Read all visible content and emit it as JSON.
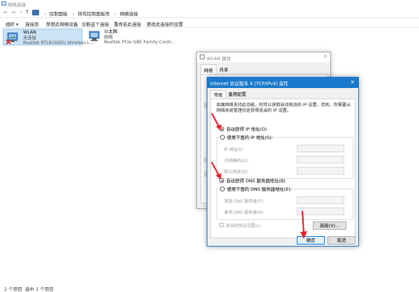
{
  "window": {
    "title": "网络连接"
  },
  "address": {
    "back": "←",
    "forward": "→",
    "dropdown": "⌄",
    "up": "↑",
    "crumbs": [
      "控制面板",
      "所有控制面板项",
      "网络连接"
    ]
  },
  "toolbar": {
    "organize": "组织 ▾",
    "connect_to": "连接到",
    "disable": "禁用此网络设备",
    "diagnose": "诊断这个连接",
    "rename": "重命名此连接",
    "change_settings": "更改此连接的设置"
  },
  "adapters": [
    {
      "name": "WLAN",
      "status": "未连接",
      "device": "Realtek RTL8192EU Wireless L...",
      "icon": "wifi-adapter-icon",
      "status_icon": "disconnected-x-icon"
    },
    {
      "name": "以太网",
      "status": "网络",
      "device": "Realtek PCIe GBE Family Contr...",
      "icon": "ethernet-adapter-icon"
    }
  ],
  "statusbar": {
    "count": "2 个项目",
    "selected": "选中 1 个项目"
  },
  "wlan_dialog": {
    "title": "WLAN 属性",
    "close": "✕",
    "tabs": [
      "网络",
      "共享"
    ]
  },
  "ipv4_dialog": {
    "title": "Internet 协议版本 4 (TCP/IPv4) 属性",
    "close": "✕",
    "tabs": [
      "常规",
      "备用配置"
    ],
    "description": "如果网络支持此功能，则可以获取自动指派的 IP 设置。否则，你需要从网络系统管理员处获得适当的 IP 设置。",
    "auto_ip": "自动获得 IP 地址(O)",
    "manual_ip": "使用下面的 IP 地址(S):",
    "ip_label": "IP 地址(I):",
    "mask_label": "子网掩码(U):",
    "gateway_label": "默认网关(D):",
    "auto_dns": "自动获得 DNS 服务器地址(B)",
    "manual_dns": "使用下面的 DNS 服务器地址(E):",
    "pref_dns_label": "首选 DNS 服务器(P):",
    "alt_dns_label": "备用 DNS 服务器(A):",
    "validate": "退出时验证设置(L)",
    "advanced": "高级(V)...",
    "ok": "确定",
    "cancel": "取消",
    "auto_ip_selected": true,
    "auto_dns_selected": true
  },
  "colors": {
    "accent": "#1979ca",
    "annotation_arrow": "#e8202a",
    "selection": "#cce4f7"
  }
}
